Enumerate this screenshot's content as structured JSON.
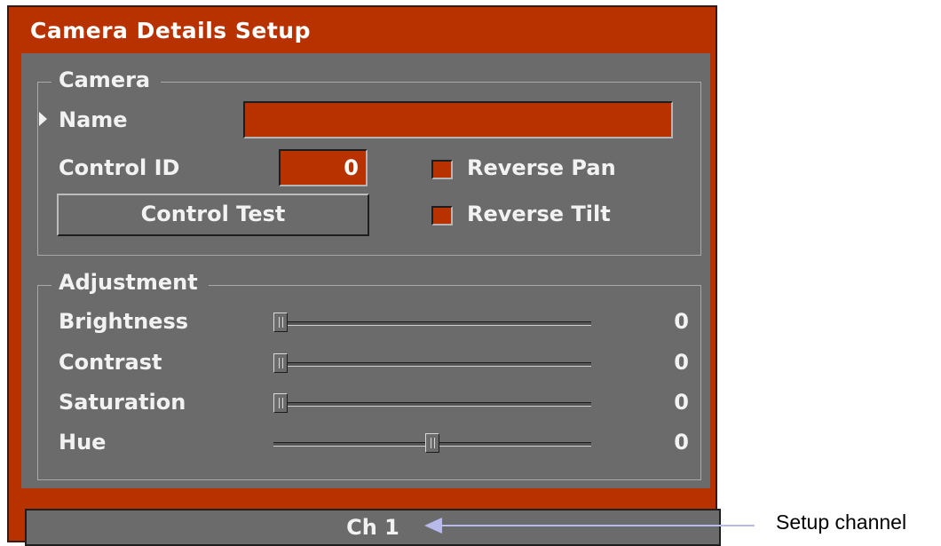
{
  "dialog": {
    "title": "Camera Details Setup"
  },
  "camera_group": {
    "title": "Camera",
    "name_label": "Name",
    "name_value": "",
    "control_id_label": "Control ID",
    "control_id_value": "0",
    "control_test_label": "Control Test",
    "reverse_pan_label": "Reverse Pan",
    "reverse_pan_checked": false,
    "reverse_tilt_label": "Reverse Tilt",
    "reverse_tilt_checked": false
  },
  "adjustment_group": {
    "title": "Adjustment",
    "sliders": [
      {
        "label": "Brightness",
        "value": "0",
        "level": 0.0
      },
      {
        "label": "Contrast",
        "value": "0",
        "level": 0.0
      },
      {
        "label": "Saturation",
        "value": "0",
        "level": 0.0
      },
      {
        "label": "Hue",
        "value": "0",
        "level": 0.5
      }
    ]
  },
  "status_bar": {
    "channel": "Ch 1"
  },
  "annotation": {
    "text": "Setup channel",
    "color": "#b9b9ec"
  },
  "colors": {
    "frame": "#b83200",
    "panel": "#6b6b6b",
    "text": "#f2f2f2"
  }
}
